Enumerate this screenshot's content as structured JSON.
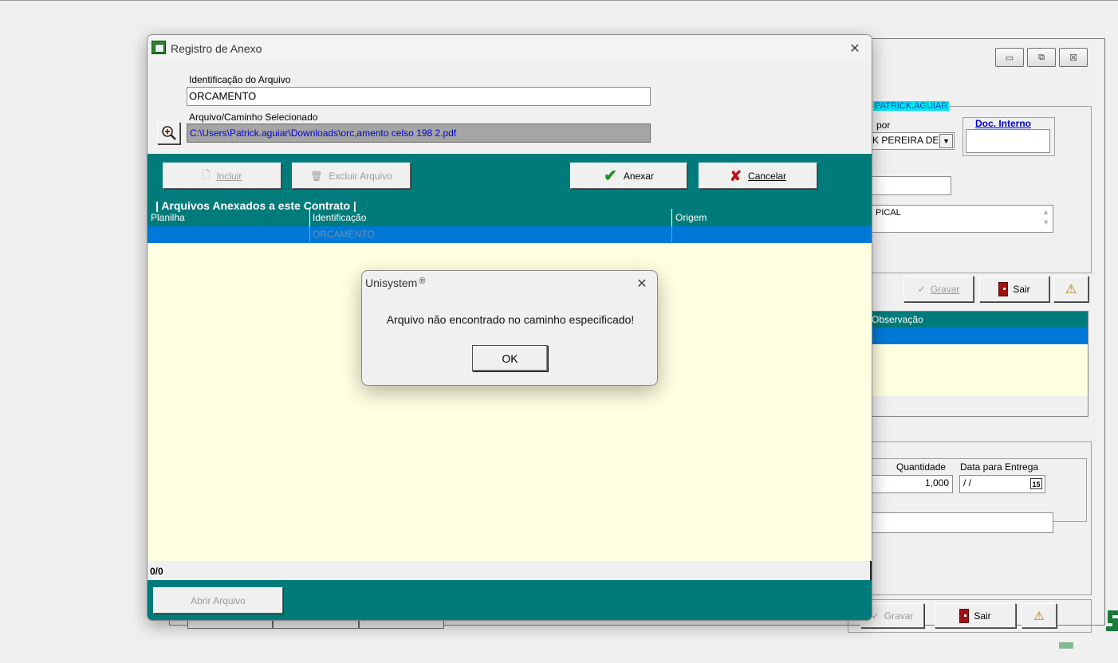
{
  "background_window": {
    "titlebar_buttons": {
      "minimize": "▭",
      "restore": "⧉",
      "close": "☒"
    },
    "user_group_title": "PATRICK.AGUIAR",
    "por_label": "por",
    "por_value": "K PEREIRA DE",
    "doc_interno_label": "Doc. Interno",
    "doc_interno_value": "",
    "text_value": "",
    "memo_value": "PICAL",
    "gravar_label": "Gravar",
    "sair_label": "Sair",
    "grid_header": "Observação",
    "quantidade_label": "Quantidade",
    "quantidade_value": "1,000",
    "data_entrega_label": "Data para Entrega",
    "data_entrega_value": "/ /",
    "calendar_label": "15",
    "bottom_gravar_label": "Gravar",
    "bottom_sair_label": "Sair"
  },
  "dialog": {
    "title": "Registro de Anexo",
    "close_glyph": "✕",
    "ident_label": "Identificação do Arquivo",
    "ident_value": "ORCAMENTO",
    "path_label": "Arquivo/Caminho Selecionado",
    "path_value": "C:\\Users\\Patrick.aguiar\\Downloads\\orc,amento celso 198 2.pdf",
    "incluir_label": "Incluir",
    "excluir_label": "Excluir Arquivo",
    "anexar_label": "Anexar",
    "cancelar_label": "Cancelar",
    "section_title": "| Arquivos Anexados a este Contrato |",
    "columns": [
      "Planilha",
      "Identificação",
      "Origem"
    ],
    "rows": [
      {
        "planilha": "",
        "identificacao": "ORCAMENTO",
        "origem": ""
      }
    ],
    "record_count": "0/0",
    "abrir_label": "Abrir Arquivo"
  },
  "message_box": {
    "title": "Unisystem",
    "title_mark": "®",
    "close_glyph": "✕",
    "message": "Arquivo não encontrado no caminho especificado!",
    "ok_label": "OK"
  },
  "colors": {
    "teal": "#007b7b",
    "selected_row": "#0078d7",
    "grid_background": "#ffffe1",
    "doc_interno_blue": "#0000cc"
  }
}
